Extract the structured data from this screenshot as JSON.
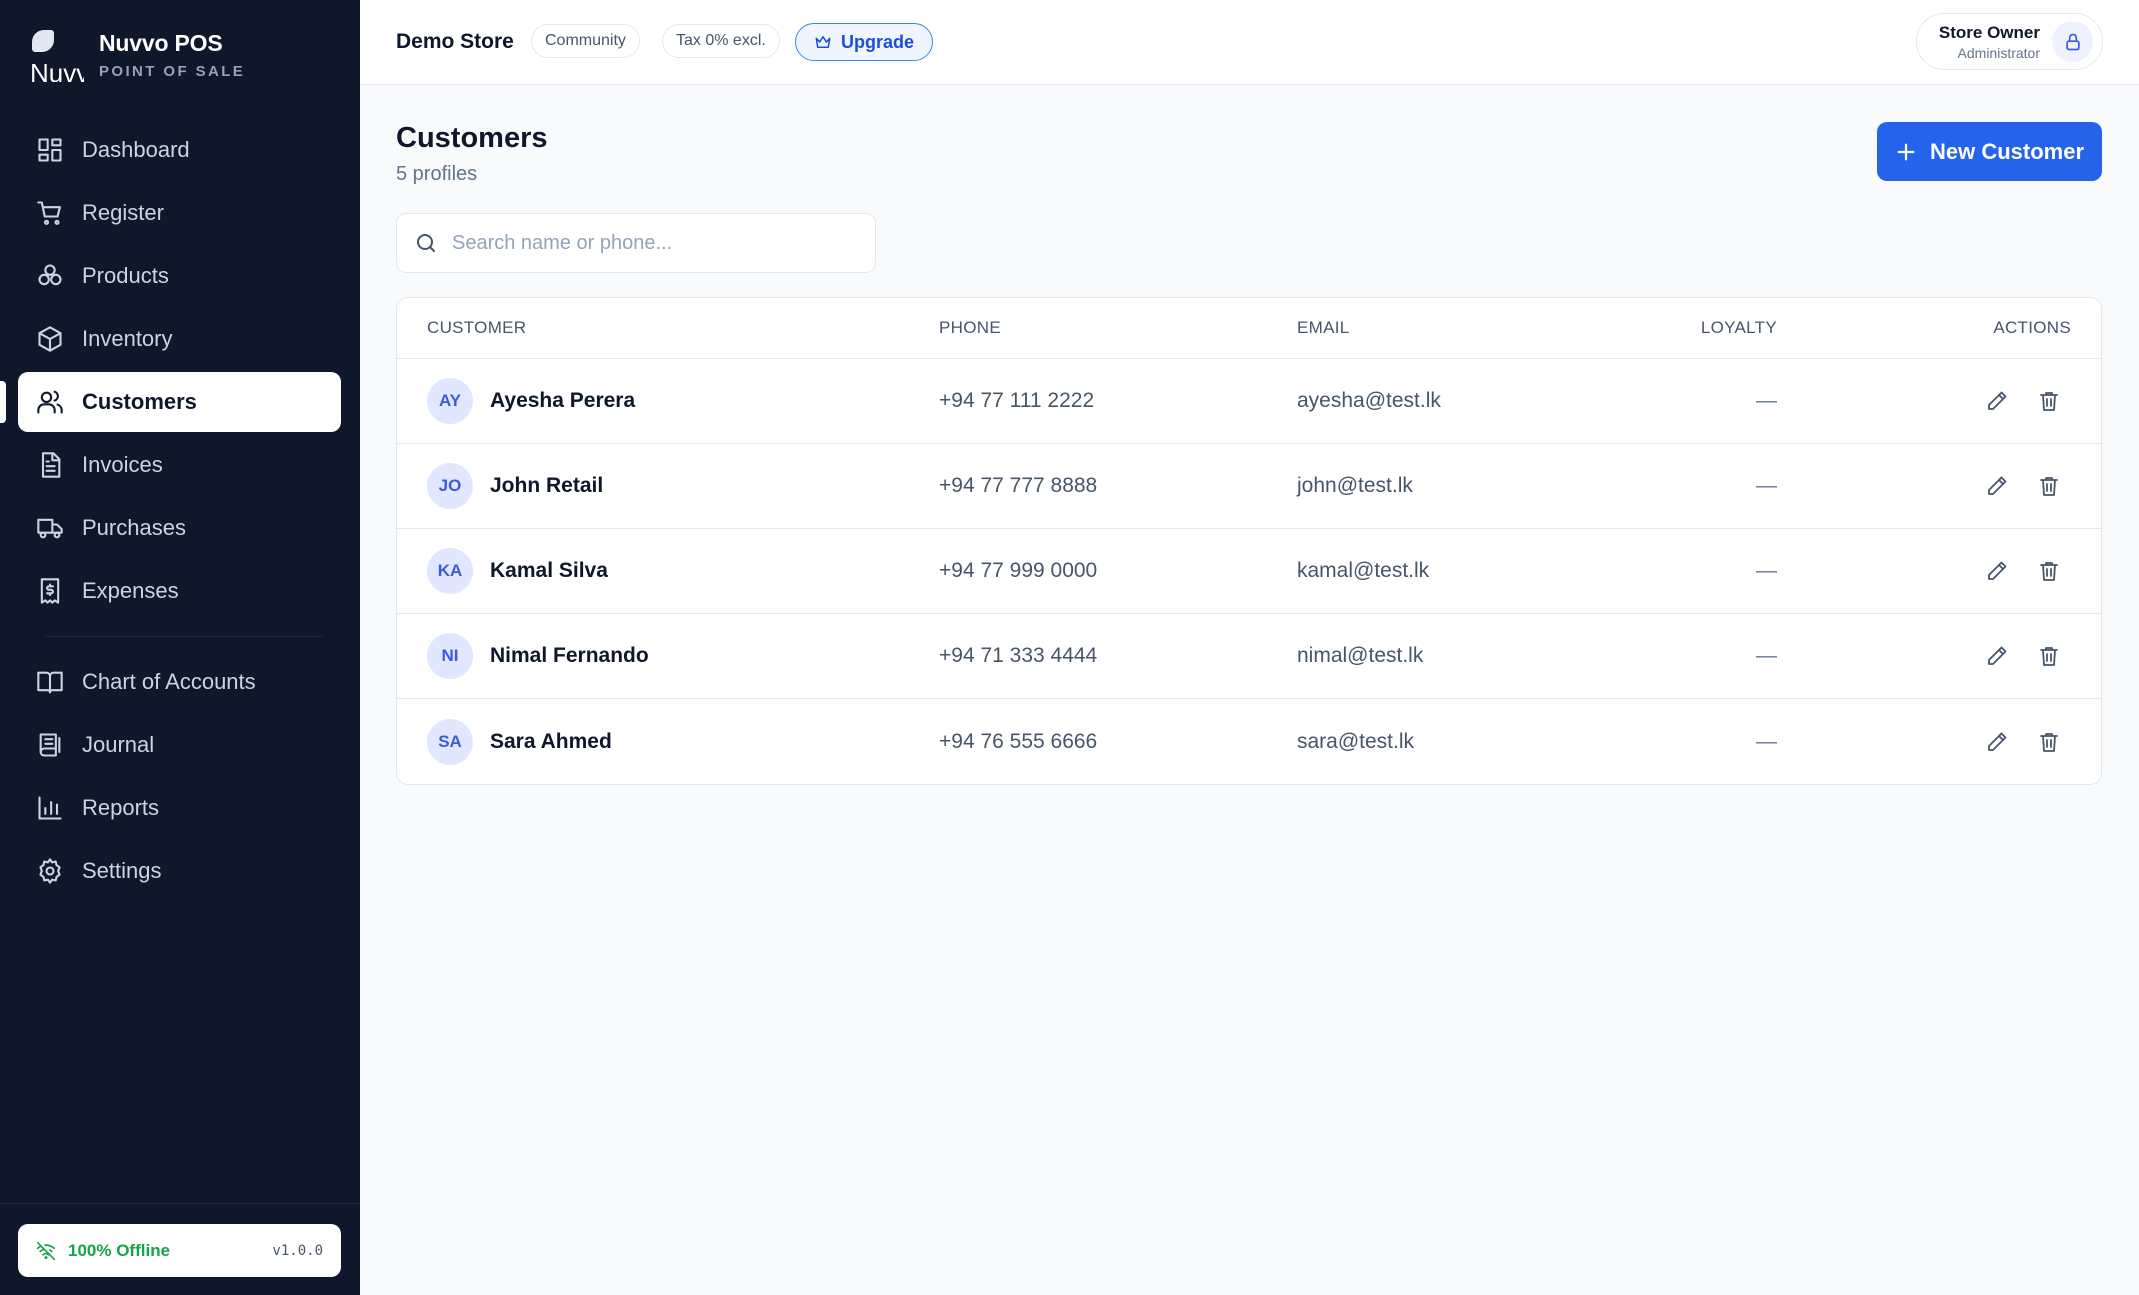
{
  "brand": {
    "logo_text": "Nuvv",
    "name": "Nuvvo POS",
    "subtitle": "POINT OF SALE"
  },
  "sidebar": {
    "items": [
      {
        "label": "Dashboard",
        "icon": "dashboard-icon"
      },
      {
        "label": "Register",
        "icon": "cart-icon"
      },
      {
        "label": "Products",
        "icon": "products-icon"
      },
      {
        "label": "Inventory",
        "icon": "box-icon"
      },
      {
        "label": "Customers",
        "icon": "users-icon",
        "active": true
      },
      {
        "label": "Invoices",
        "icon": "invoice-icon"
      },
      {
        "label": "Purchases",
        "icon": "truck-icon"
      },
      {
        "label": "Expenses",
        "icon": "receipt-icon"
      },
      {
        "label": "Chart of Accounts",
        "icon": "book-icon"
      },
      {
        "label": "Journal",
        "icon": "journal-icon"
      },
      {
        "label": "Reports",
        "icon": "bar-chart-icon"
      },
      {
        "label": "Settings",
        "icon": "gear-icon"
      }
    ],
    "footer": {
      "status": "100% Offline",
      "version": "v1.0.0"
    }
  },
  "header": {
    "store": "Demo Store",
    "plan": "Community",
    "tax": "Tax 0% excl.",
    "upgrade": "Upgrade",
    "user": {
      "name": "Store Owner",
      "role": "Administrator"
    }
  },
  "page": {
    "title": "Customers",
    "subtitle": "5 profiles",
    "new_button": "New Customer",
    "search_placeholder": "Search name or phone..."
  },
  "table": {
    "columns": [
      "CUSTOMER",
      "PHONE",
      "EMAIL",
      "LOYALTY",
      "ACTIONS"
    ],
    "rows": [
      {
        "initials": "AY",
        "name": "Ayesha Perera",
        "phone": "+94 77 111 2222",
        "email": "ayesha@test.lk",
        "loyalty": "—"
      },
      {
        "initials": "JO",
        "name": "John Retail",
        "phone": "+94 77 777 8888",
        "email": "john@test.lk",
        "loyalty": "—"
      },
      {
        "initials": "KA",
        "name": "Kamal Silva",
        "phone": "+94 77 999 0000",
        "email": "kamal@test.lk",
        "loyalty": "—"
      },
      {
        "initials": "NI",
        "name": "Nimal Fernando",
        "phone": "+94 71 333 4444",
        "email": "nimal@test.lk",
        "loyalty": "—"
      },
      {
        "initials": "SA",
        "name": "Sara Ahmed",
        "phone": "+94 76 555 6666",
        "email": "sara@test.lk",
        "loyalty": "—"
      }
    ]
  },
  "colors": {
    "sidebar_bg": "#0f172a",
    "accent": "#2563eb",
    "offline_green": "#16a34a"
  }
}
